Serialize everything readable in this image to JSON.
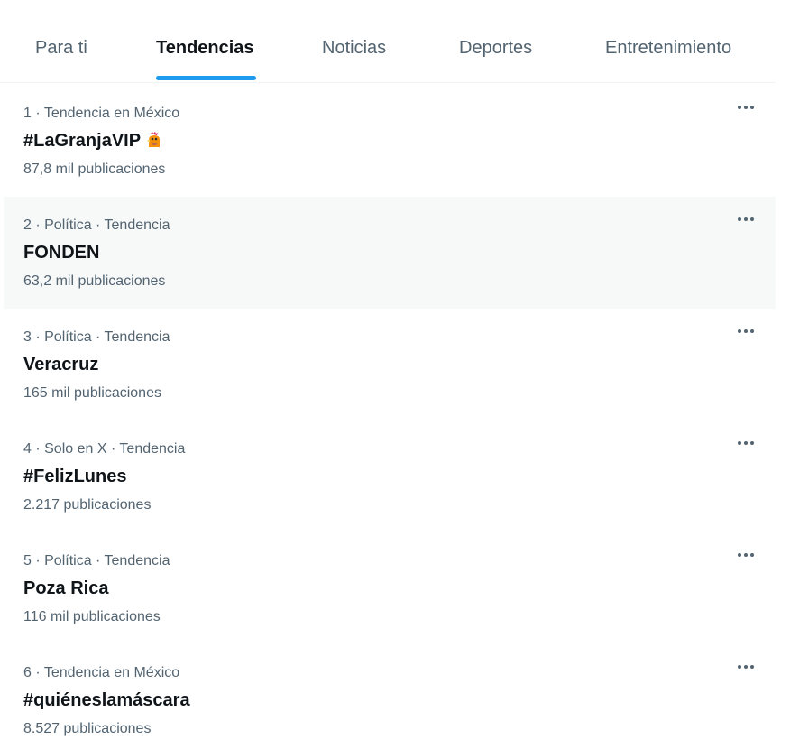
{
  "tabs": [
    {
      "label": "Para ti",
      "active": false
    },
    {
      "label": "Tendencias",
      "active": true
    },
    {
      "label": "Noticias",
      "active": false
    },
    {
      "label": "Deportes",
      "active": false
    },
    {
      "label": "Entretenimiento",
      "active": false
    }
  ],
  "colors": {
    "accent": "#1d9bf0",
    "text_primary": "#0f1419",
    "text_secondary": "#536471",
    "divider": "#eff3f4",
    "hover_bg": "#f7f9f9"
  },
  "trends": [
    {
      "meta": "1 · Tendencia en México",
      "name": "#LaGranjaVIP",
      "emoji": "rooster-icon",
      "count": "87,8 mil publicaciones",
      "more_icon": "more-icon"
    },
    {
      "meta": "2 · Política · Tendencia",
      "name": "FONDEN",
      "count": "63,2 mil publicaciones",
      "more_icon": "more-icon"
    },
    {
      "meta": "3 · Política · Tendencia",
      "name": "Veracruz",
      "count": "165 mil publicaciones",
      "more_icon": "more-icon"
    },
    {
      "meta": "4 · Solo en X · Tendencia",
      "name": "#FelizLunes",
      "count": "2.217 publicaciones",
      "more_icon": "more-icon"
    },
    {
      "meta": "5 · Política · Tendencia",
      "name": "Poza Rica",
      "count": "116 mil publicaciones",
      "more_icon": "more-icon"
    },
    {
      "meta": "6 · Tendencia en México",
      "name": "#quiéneslamáscara",
      "count": "8.527 publicaciones",
      "more_icon": "more-icon"
    }
  ]
}
